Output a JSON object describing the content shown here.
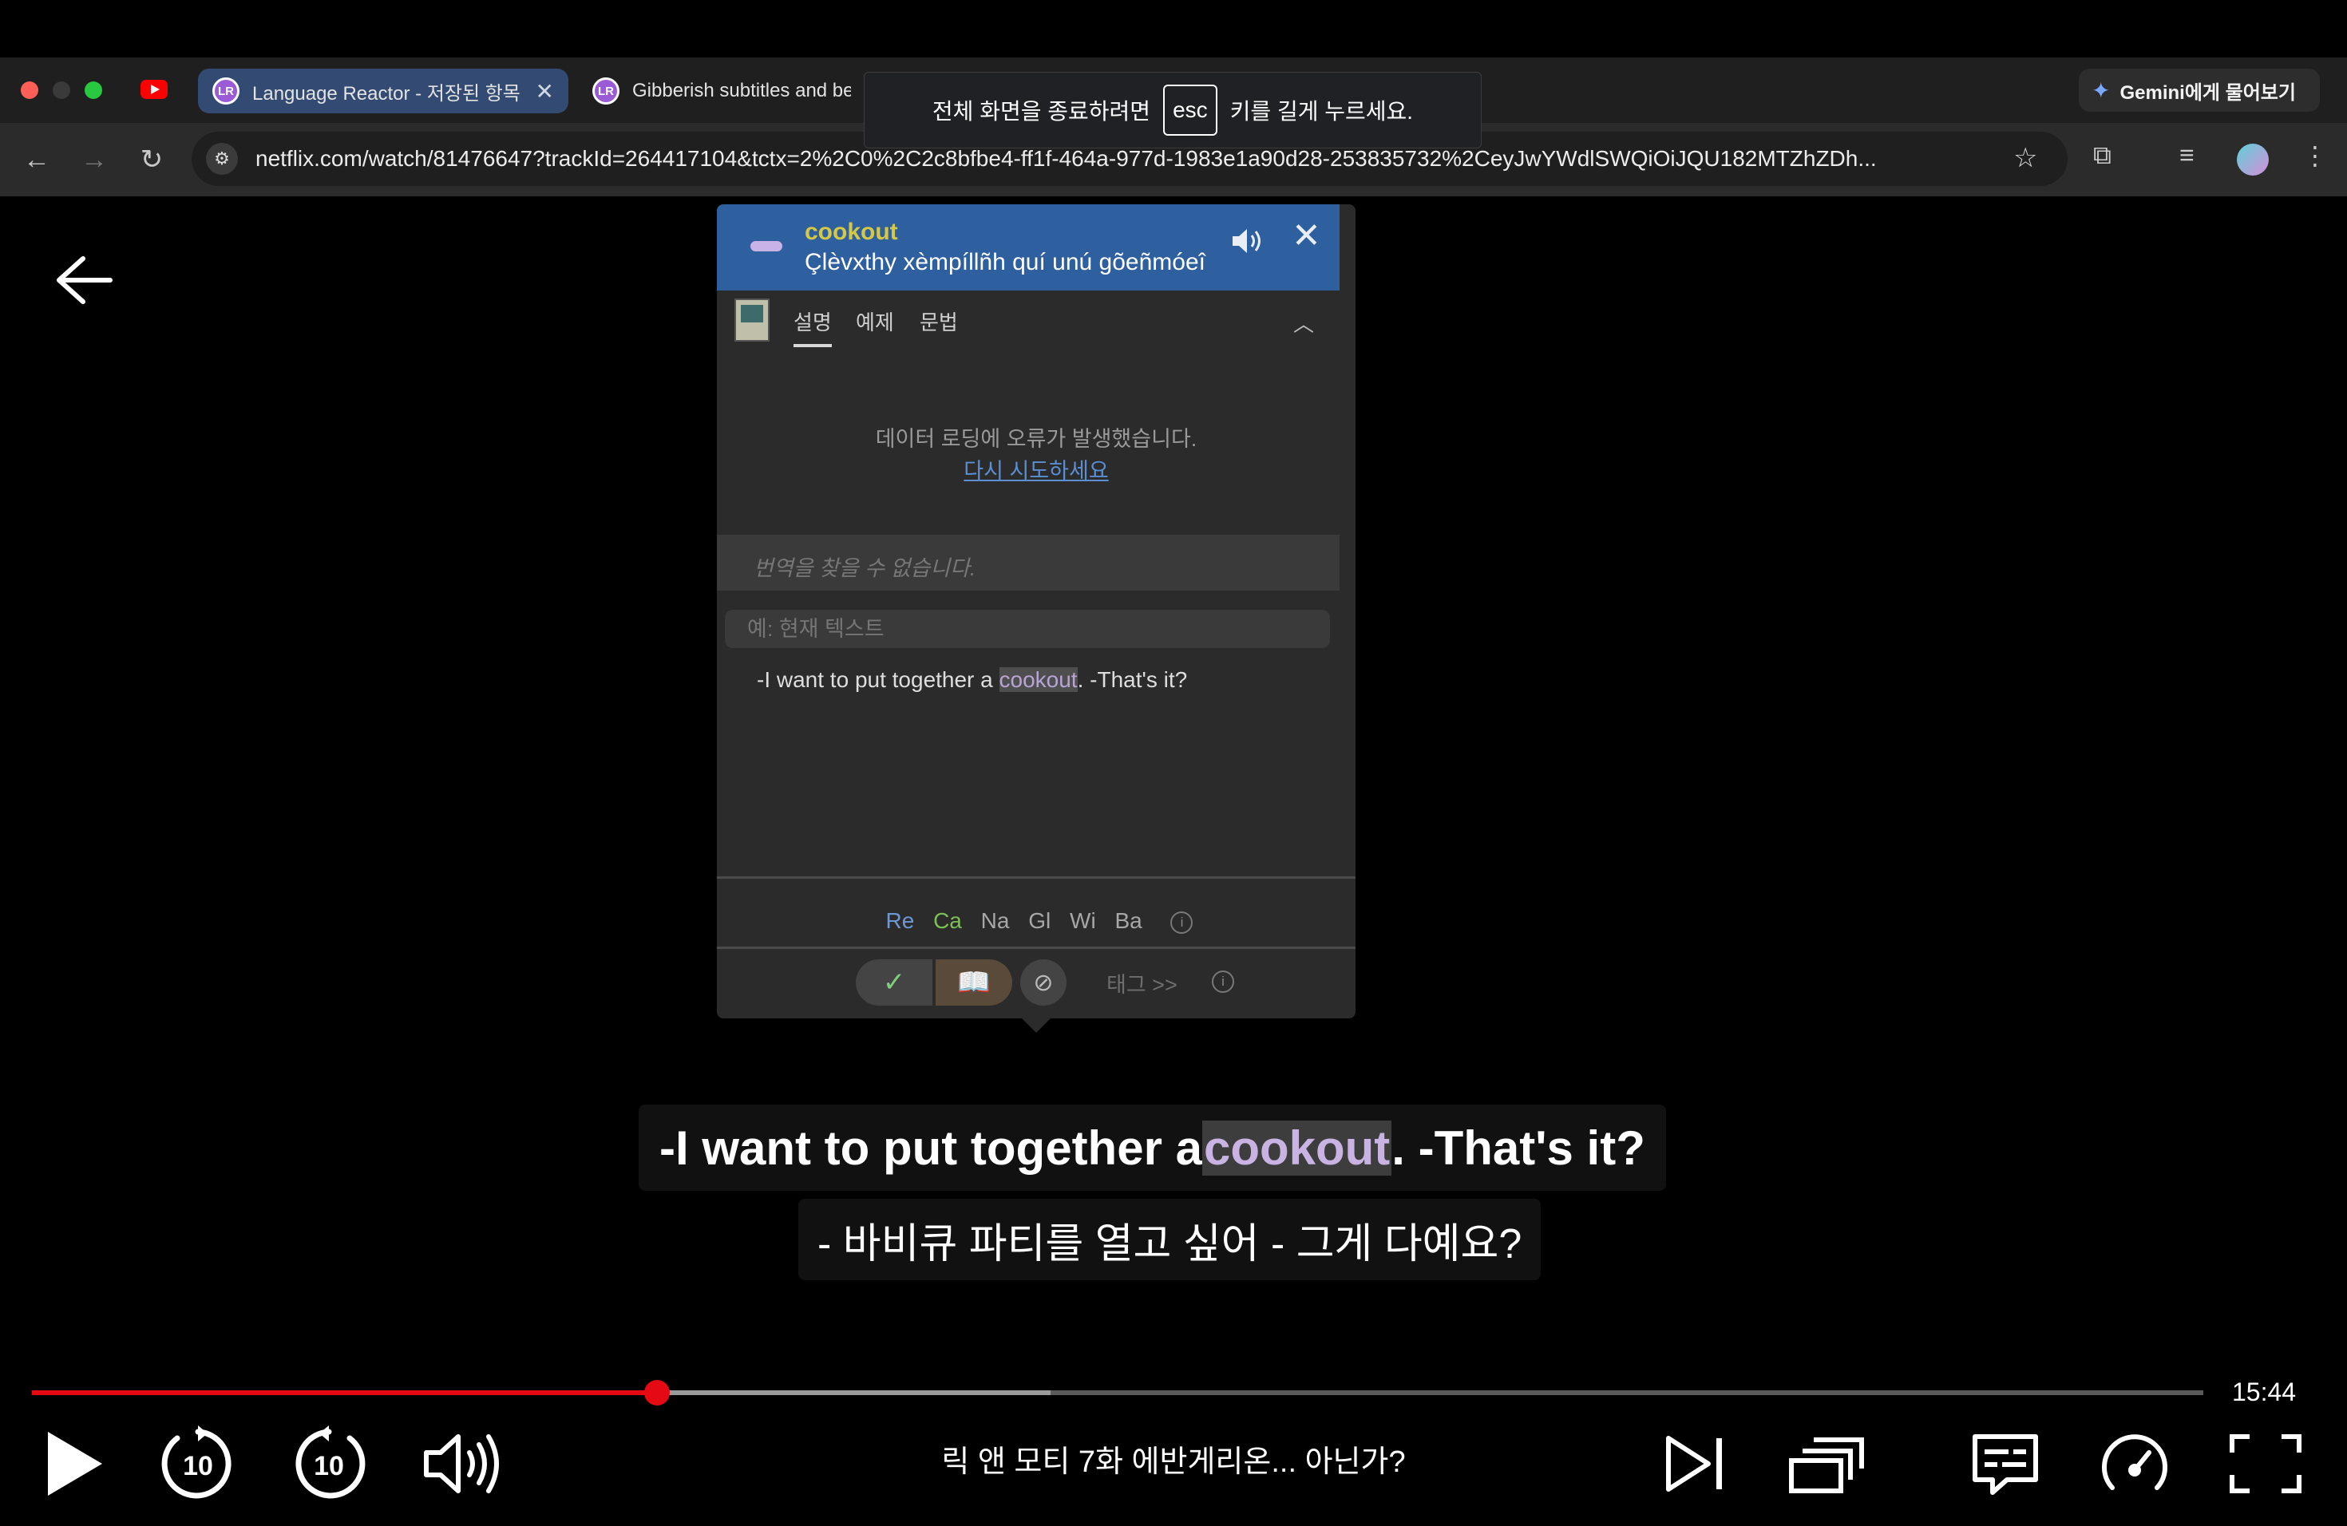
{
  "browser": {
    "tabs": [
      {
        "title": "Language Reactor - 저장된 항목",
        "active": true
      },
      {
        "title": "Gibberish subtitles and be",
        "active": false
      }
    ],
    "gemini_label": "Gemini에게 물어보기",
    "url": "netflix.com/watch/81476647?trackId=264417104&tctx=2%2C0%2C2c8bfbe4-ff1f-464a-977d-1983e1a90d28-253835732%2CeyJwYWdlSWQiOiJQU182MTZhZDh...",
    "fullscreen_toast": {
      "before": "전체 화면을 종료하려면",
      "key": "esc",
      "after": "키를 길게 누르세요."
    }
  },
  "popup": {
    "word": "cookout",
    "gibberish": "Çlèvxthy xèmpíllñh quí unú gõeñmóeî",
    "tabs": [
      "설명",
      "예제",
      "문법"
    ],
    "error_message": "데이터 로딩에 오류가 발생했습니다.",
    "retry_label": "다시 시도하세요",
    "no_translation": "번역을 찾을 수 없습니다.",
    "example_placeholder": "예: 현재 텍스트",
    "example_sentence": {
      "before": "-I want to put together a ",
      "highlight": "cookout",
      "after": ". -That's it?"
    },
    "dictionaries": [
      "Re",
      "Ca",
      "Na",
      "Gl",
      "Wi",
      "Ba"
    ],
    "tag_label": "태그 >>"
  },
  "subtitles": {
    "english": {
      "before": "-I want to put together a ",
      "highlight": "cookout",
      "after": ". -That's it?"
    },
    "korean": "- 바비큐 파티를 열고 싶어 - 그게 다예요?"
  },
  "player": {
    "time_remaining": "15:44",
    "episode_title": "릭 앤 모티 7화  에반게리온... 아닌가?",
    "progress": 0.288,
    "buffered": 0.469,
    "skip_seconds": "10",
    "accent_color": "#e50914"
  }
}
